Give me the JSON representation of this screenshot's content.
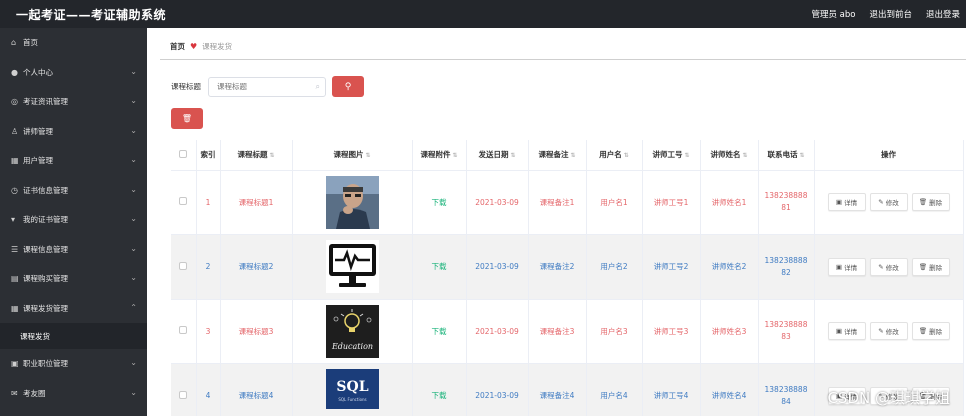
{
  "header": {
    "title": "一起考证——考证辅助系统",
    "admin_label": "管理员 abo",
    "back_front_label": "退出到前台",
    "logout_label": "退出登录"
  },
  "sidebar": {
    "items": [
      {
        "label": "首页",
        "icon": "home-icon",
        "chevron": false
      },
      {
        "label": "个人中心",
        "icon": "user-icon",
        "chevron": true
      },
      {
        "label": "考证资讯管理",
        "icon": "news-icon",
        "chevron": true
      },
      {
        "label": "讲师管理",
        "icon": "lecturer-icon",
        "chevron": true
      },
      {
        "label": "用户管理",
        "icon": "users-icon",
        "chevron": true
      },
      {
        "label": "证书信息管理",
        "icon": "certificate-icon",
        "chevron": true
      },
      {
        "label": "我的证书管理",
        "icon": "badge-icon",
        "chevron": true
      },
      {
        "label": "课程信息管理",
        "icon": "list-icon",
        "chevron": true
      },
      {
        "label": "课程购买管理",
        "icon": "cart-icon",
        "chevron": true
      },
      {
        "label": "课程发货管理",
        "icon": "grid-icon",
        "chevron": true,
        "expanded": true
      }
    ],
    "sub_item": "课程发货",
    "items_after": [
      {
        "label": "职业职位管理",
        "icon": "job-icon",
        "chevron": true
      },
      {
        "label": "考友圈",
        "icon": "message-icon",
        "chevron": true
      }
    ]
  },
  "breadcrumb": {
    "home": "首页",
    "current": "课程发货"
  },
  "search": {
    "label": "课程标题",
    "placeholder": "课程标题"
  },
  "table": {
    "headers": [
      "索引",
      "课程标题",
      "课程图片",
      "课程附件",
      "发送日期",
      "课程备注",
      "用户名",
      "讲师工号",
      "讲师姓名",
      "联系电话",
      "操作"
    ],
    "rows": [
      {
        "index": "1",
        "title": "课程标题1",
        "image": "man-thinking-photo",
        "attachment": "下载",
        "date": "2021-03-09",
        "remark": "课程备注1",
        "username": "用户名1",
        "lecturer_no": "讲师工号1",
        "lecturer_name": "讲师姓名1",
        "phone": "13823888881"
      },
      {
        "index": "2",
        "title": "课程标题2",
        "image": "monitor-heartbeat-icon",
        "attachment": "下载",
        "date": "2021-03-09",
        "remark": "课程备注2",
        "username": "用户名2",
        "lecturer_no": "讲师工号2",
        "lecturer_name": "讲师姓名2",
        "phone": "13823888882"
      },
      {
        "index": "3",
        "title": "课程标题3",
        "image": "education-chalkboard-photo",
        "attachment": "下载",
        "date": "2021-03-09",
        "remark": "课程备注3",
        "username": "用户名3",
        "lecturer_no": "讲师工号3",
        "lecturer_name": "讲师姓名3",
        "phone": "13823888883"
      },
      {
        "index": "4",
        "title": "课程标题4",
        "image": "sql-book-cover",
        "attachment": "下载",
        "date": "2021-03-09",
        "remark": "课程备注4",
        "username": "用户名4",
        "lecturer_no": "讲师工号4",
        "lecturer_name": "讲师姓名4",
        "phone": "13823888884"
      }
    ],
    "image_text": {
      "education": "Education",
      "sql": "SQL",
      "sql_sub": "SQL Functions"
    },
    "actions": {
      "detail": "详情",
      "edit": "修改",
      "delete": "删除"
    }
  },
  "watermark": "CSDN @琪琪学姐",
  "colors": {
    "topbar": "#23262b",
    "sidebar": "#2c2f34",
    "accent_red": "#d9534f",
    "odd_row_text": "#e4666a",
    "even_row_text": "#3f7bc2",
    "download_text": "#19b37a"
  }
}
